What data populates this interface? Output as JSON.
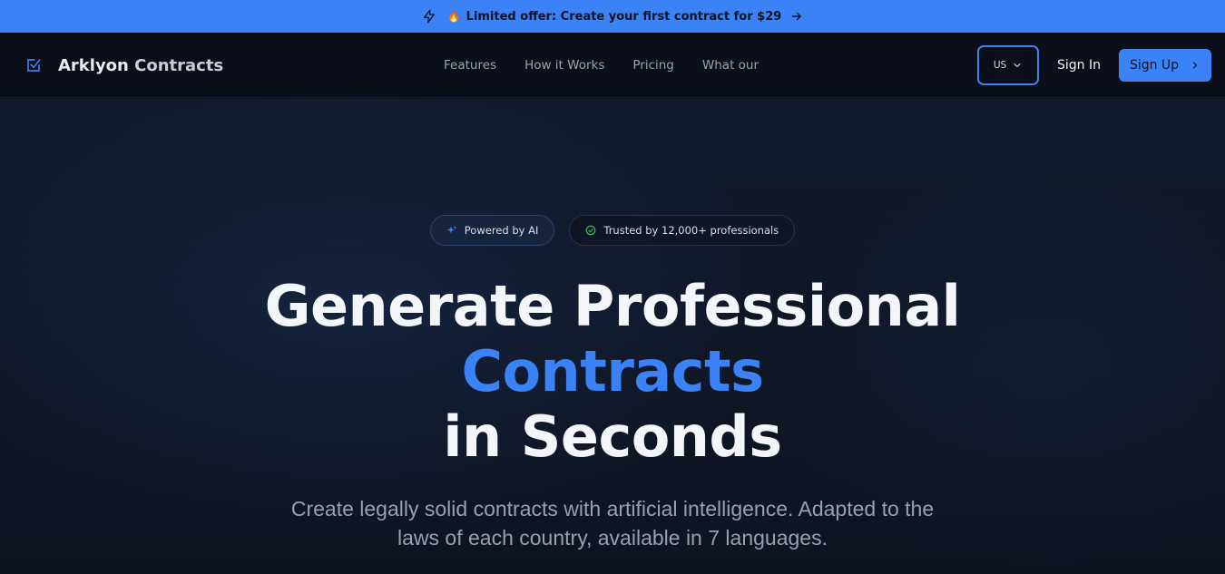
{
  "promo": {
    "text": "Limited offer: Create your first contract for $29",
    "icon": "lightning-icon",
    "emoji": "🔥"
  },
  "brand": {
    "name_main": "Arklyon",
    "name_rest": "Contracts"
  },
  "nav": {
    "links": [
      "Features",
      "How it Works",
      "Pricing",
      "What our"
    ],
    "language": "US",
    "signin_label": "Sign In",
    "signup_label": "Sign Up"
  },
  "hero": {
    "badge_ai": "Powered by AI",
    "badge_trust": "Trusted by 12,000+ professionals",
    "headline_line1": "Generate Professional",
    "headline_accent": "Contracts",
    "headline_line3": "in Seconds",
    "subtitle_line1": "Create legally solid contracts with artificial intelligence. Adapted to the",
    "subtitle_line2": "laws of each country, available in 7 languages."
  },
  "colors": {
    "accent": "#3b82f6",
    "background": "#0d1320",
    "nav_background": "#0b0f19"
  }
}
